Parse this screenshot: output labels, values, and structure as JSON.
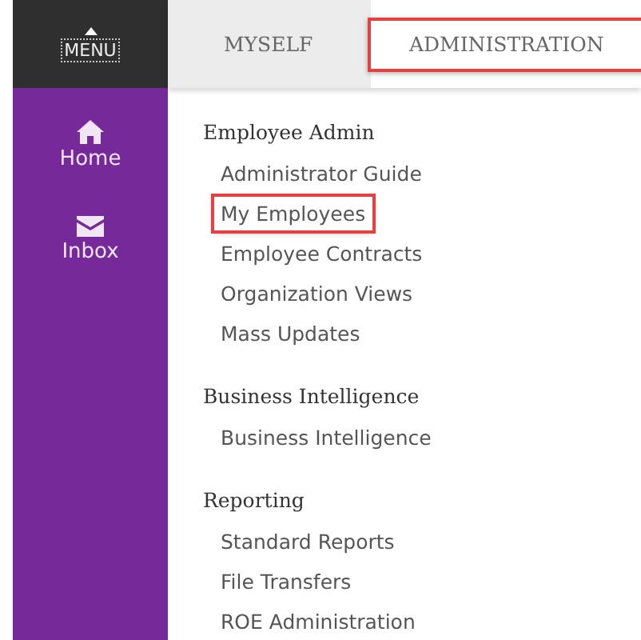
{
  "menu_button": {
    "label": "MENU",
    "focused": true
  },
  "tabs": [
    {
      "label": "MYSELF",
      "selected": false,
      "highlighted": false
    },
    {
      "label": "ADMINISTRATION",
      "selected": true,
      "highlighted": true
    }
  ],
  "sidebar": {
    "items": [
      {
        "label": "Home",
        "kind": "home"
      },
      {
        "label": "Inbox",
        "kind": "inbox"
      }
    ]
  },
  "sections": [
    {
      "title": "Employee Admin",
      "items": [
        {
          "label": "Administrator Guide",
          "highlighted": false
        },
        {
          "label": "My Employees",
          "highlighted": true
        },
        {
          "label": "Employee Contracts",
          "highlighted": false
        },
        {
          "label": "Organization Views",
          "highlighted": false
        },
        {
          "label": "Mass Updates",
          "highlighted": false
        }
      ]
    },
    {
      "title": "Business Intelligence",
      "items": [
        {
          "label": "Business Intelligence",
          "highlighted": false
        }
      ]
    },
    {
      "title": "Reporting",
      "items": [
        {
          "label": "Standard Reports",
          "highlighted": false
        },
        {
          "label": "File Transfers",
          "highlighted": false
        },
        {
          "label": "ROE Administration",
          "highlighted": false
        }
      ]
    }
  ]
}
